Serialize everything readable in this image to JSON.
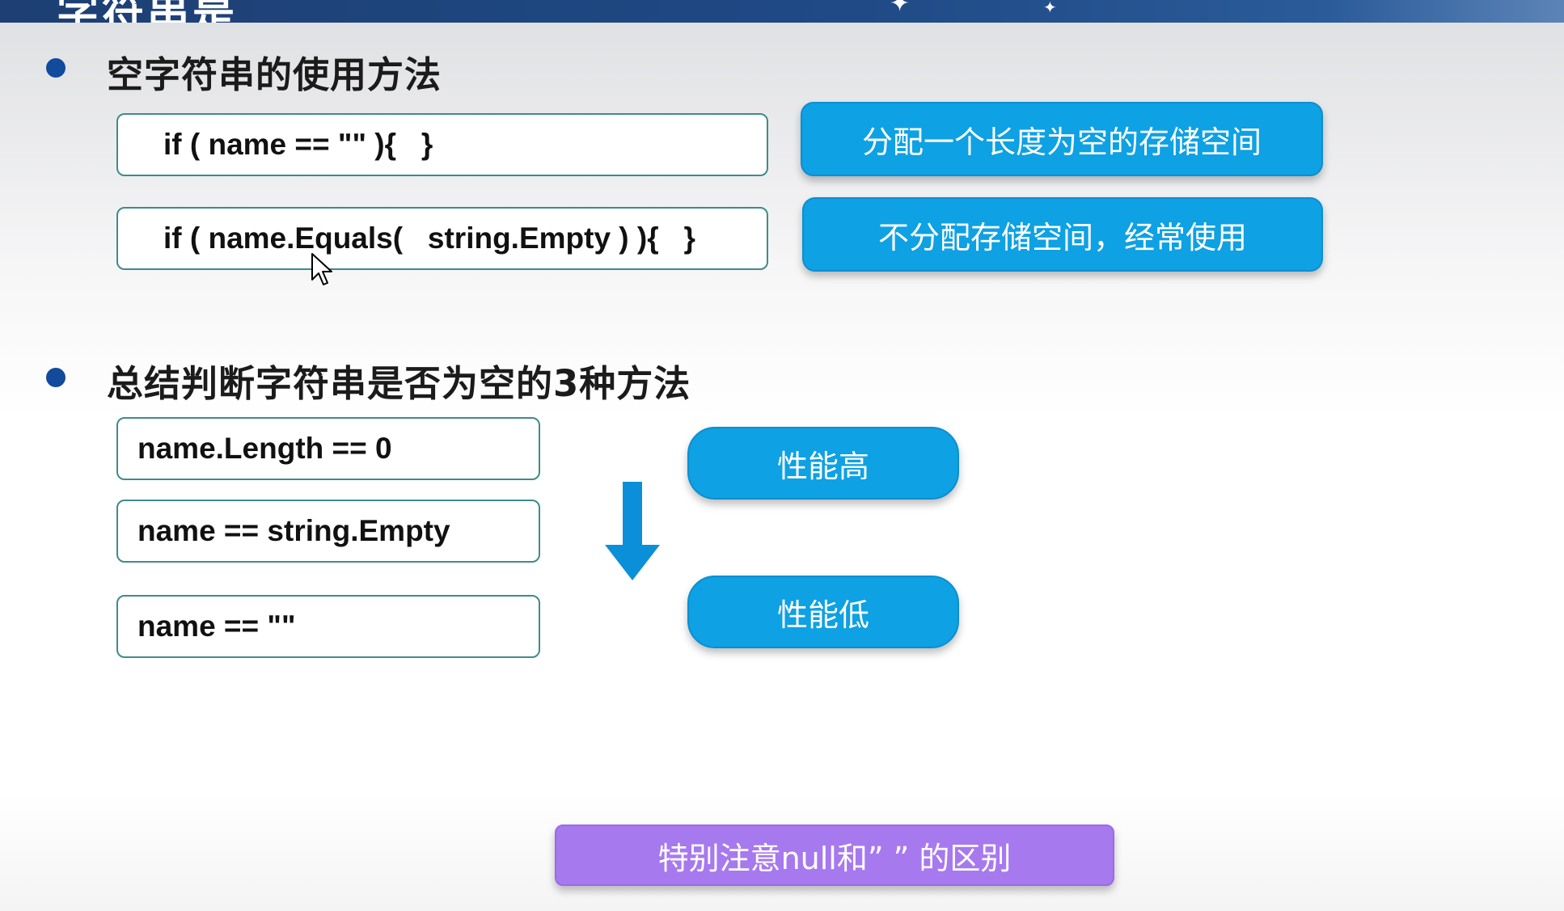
{
  "header": {
    "title_fragment": "字符串是"
  },
  "section1": {
    "title": "空字符串的使用方法",
    "code1": "if ( name == \"\" ){   }",
    "code2": "if ( name.Equals(   string.Empty ) ){   }",
    "note1": "分配一个长度为空的存储空间",
    "note2": "不分配存储空间，经常使用"
  },
  "section2": {
    "title": "总结判断字符串是否为空的3种方法",
    "methods": [
      "name.Length == 0",
      "name == string.Empty",
      "name == \"\""
    ],
    "perf_high": "性能高",
    "perf_low": "性能低"
  },
  "footer_note": "特别注意null和”  ” 的区别",
  "colors": {
    "header_blue": "#1f4a86",
    "bullet": "#124a9c",
    "accent_blue": "#0ea1e3",
    "accent_purple": "#a779ee",
    "box_border": "#3f8b8a"
  },
  "icons": [
    "bullet-dot",
    "down-arrow-icon",
    "mouse-cursor-icon",
    "star-icon"
  ]
}
